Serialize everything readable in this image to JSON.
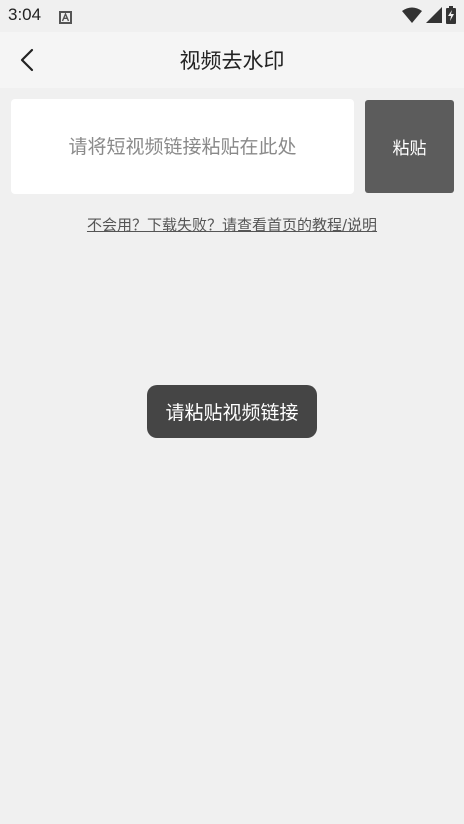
{
  "status_bar": {
    "time": "3:04",
    "app_icon": "a-icon",
    "wifi_icon": "wifi-icon",
    "signal_icon": "signal-icon",
    "battery_icon": "battery-charging-icon"
  },
  "app_bar": {
    "back_icon": "back-arrow-icon",
    "title": "视频去水印"
  },
  "input": {
    "placeholder": "请将短视频链接粘贴在此处",
    "value": ""
  },
  "paste_button": {
    "label": "粘贴"
  },
  "help_link": {
    "text": "不会用？下载失败？请查看首页的教程/说明"
  },
  "toast": {
    "text": "请粘贴视频链接"
  },
  "colors": {
    "background": "#f0f0f0",
    "paste_button": "#5c5c5c",
    "toast": "#454545"
  }
}
